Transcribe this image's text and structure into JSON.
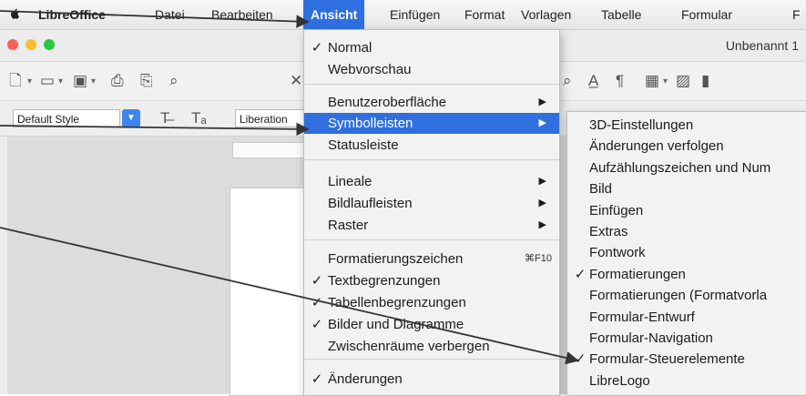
{
  "menubar": {
    "app": "LibreOffice",
    "items": [
      {
        "label": "Datei"
      },
      {
        "label": "Bearbeiten"
      },
      {
        "label": "Ansicht"
      },
      {
        "label": "Einfügen"
      },
      {
        "label": "Format"
      },
      {
        "label": "Vorlagen"
      },
      {
        "label": "Tabelle"
      },
      {
        "label": "Formular"
      },
      {
        "label": "F"
      }
    ]
  },
  "window": {
    "title": "Unbenannt 1",
    "traffic_colors": [
      "#ff5f57",
      "#febc2e",
      "#28c840"
    ]
  },
  "toolbar2": {
    "style_value": "Default Style",
    "font_value": "Liberation"
  },
  "view_menu": {
    "items": [
      {
        "label": "Normal",
        "checked": true
      },
      {
        "label": "Webvorschau"
      },
      {
        "label": "Benutzeroberfläche",
        "submenu": true
      },
      {
        "label": "Symbolleisten",
        "submenu": true,
        "highlighted": true
      },
      {
        "label": "Statusleiste"
      },
      {
        "label": "Lineale",
        "submenu": true
      },
      {
        "label": "Bildlaufleisten",
        "submenu": true
      },
      {
        "label": "Raster",
        "submenu": true
      },
      {
        "label": "Formatierungszeichen",
        "shortcut": "⌘F10"
      },
      {
        "label": "Textbegrenzungen",
        "checked": true
      },
      {
        "label": "Tabellenbegrenzungen",
        "checked": true
      },
      {
        "label": "Bilder und Diagramme",
        "checked": true
      },
      {
        "label": "Zwischenräume verbergen"
      },
      {
        "label": "Änderungen",
        "checked": true
      }
    ]
  },
  "toolbars_submenu": {
    "items": [
      {
        "label": "3D-Einstellungen"
      },
      {
        "label": "Änderungen verfolgen"
      },
      {
        "label": "Aufzählungszeichen und Num"
      },
      {
        "label": "Bild"
      },
      {
        "label": "Einfügen"
      },
      {
        "label": "Extras"
      },
      {
        "label": "Fontwork"
      },
      {
        "label": "Formatierungen",
        "checked": true
      },
      {
        "label": "Formatierungen (Formatvorla"
      },
      {
        "label": "Formular-Entwurf"
      },
      {
        "label": "Formular-Navigation"
      },
      {
        "label": "Formular-Steuerelemente",
        "checked": true
      },
      {
        "label": "LibreLogo"
      }
    ]
  },
  "glyphs": {
    "check": "✓",
    "submenu_arrow": "▶"
  },
  "colors": {
    "highlight": "#2f6fe0",
    "annotation_line": "#333333"
  }
}
